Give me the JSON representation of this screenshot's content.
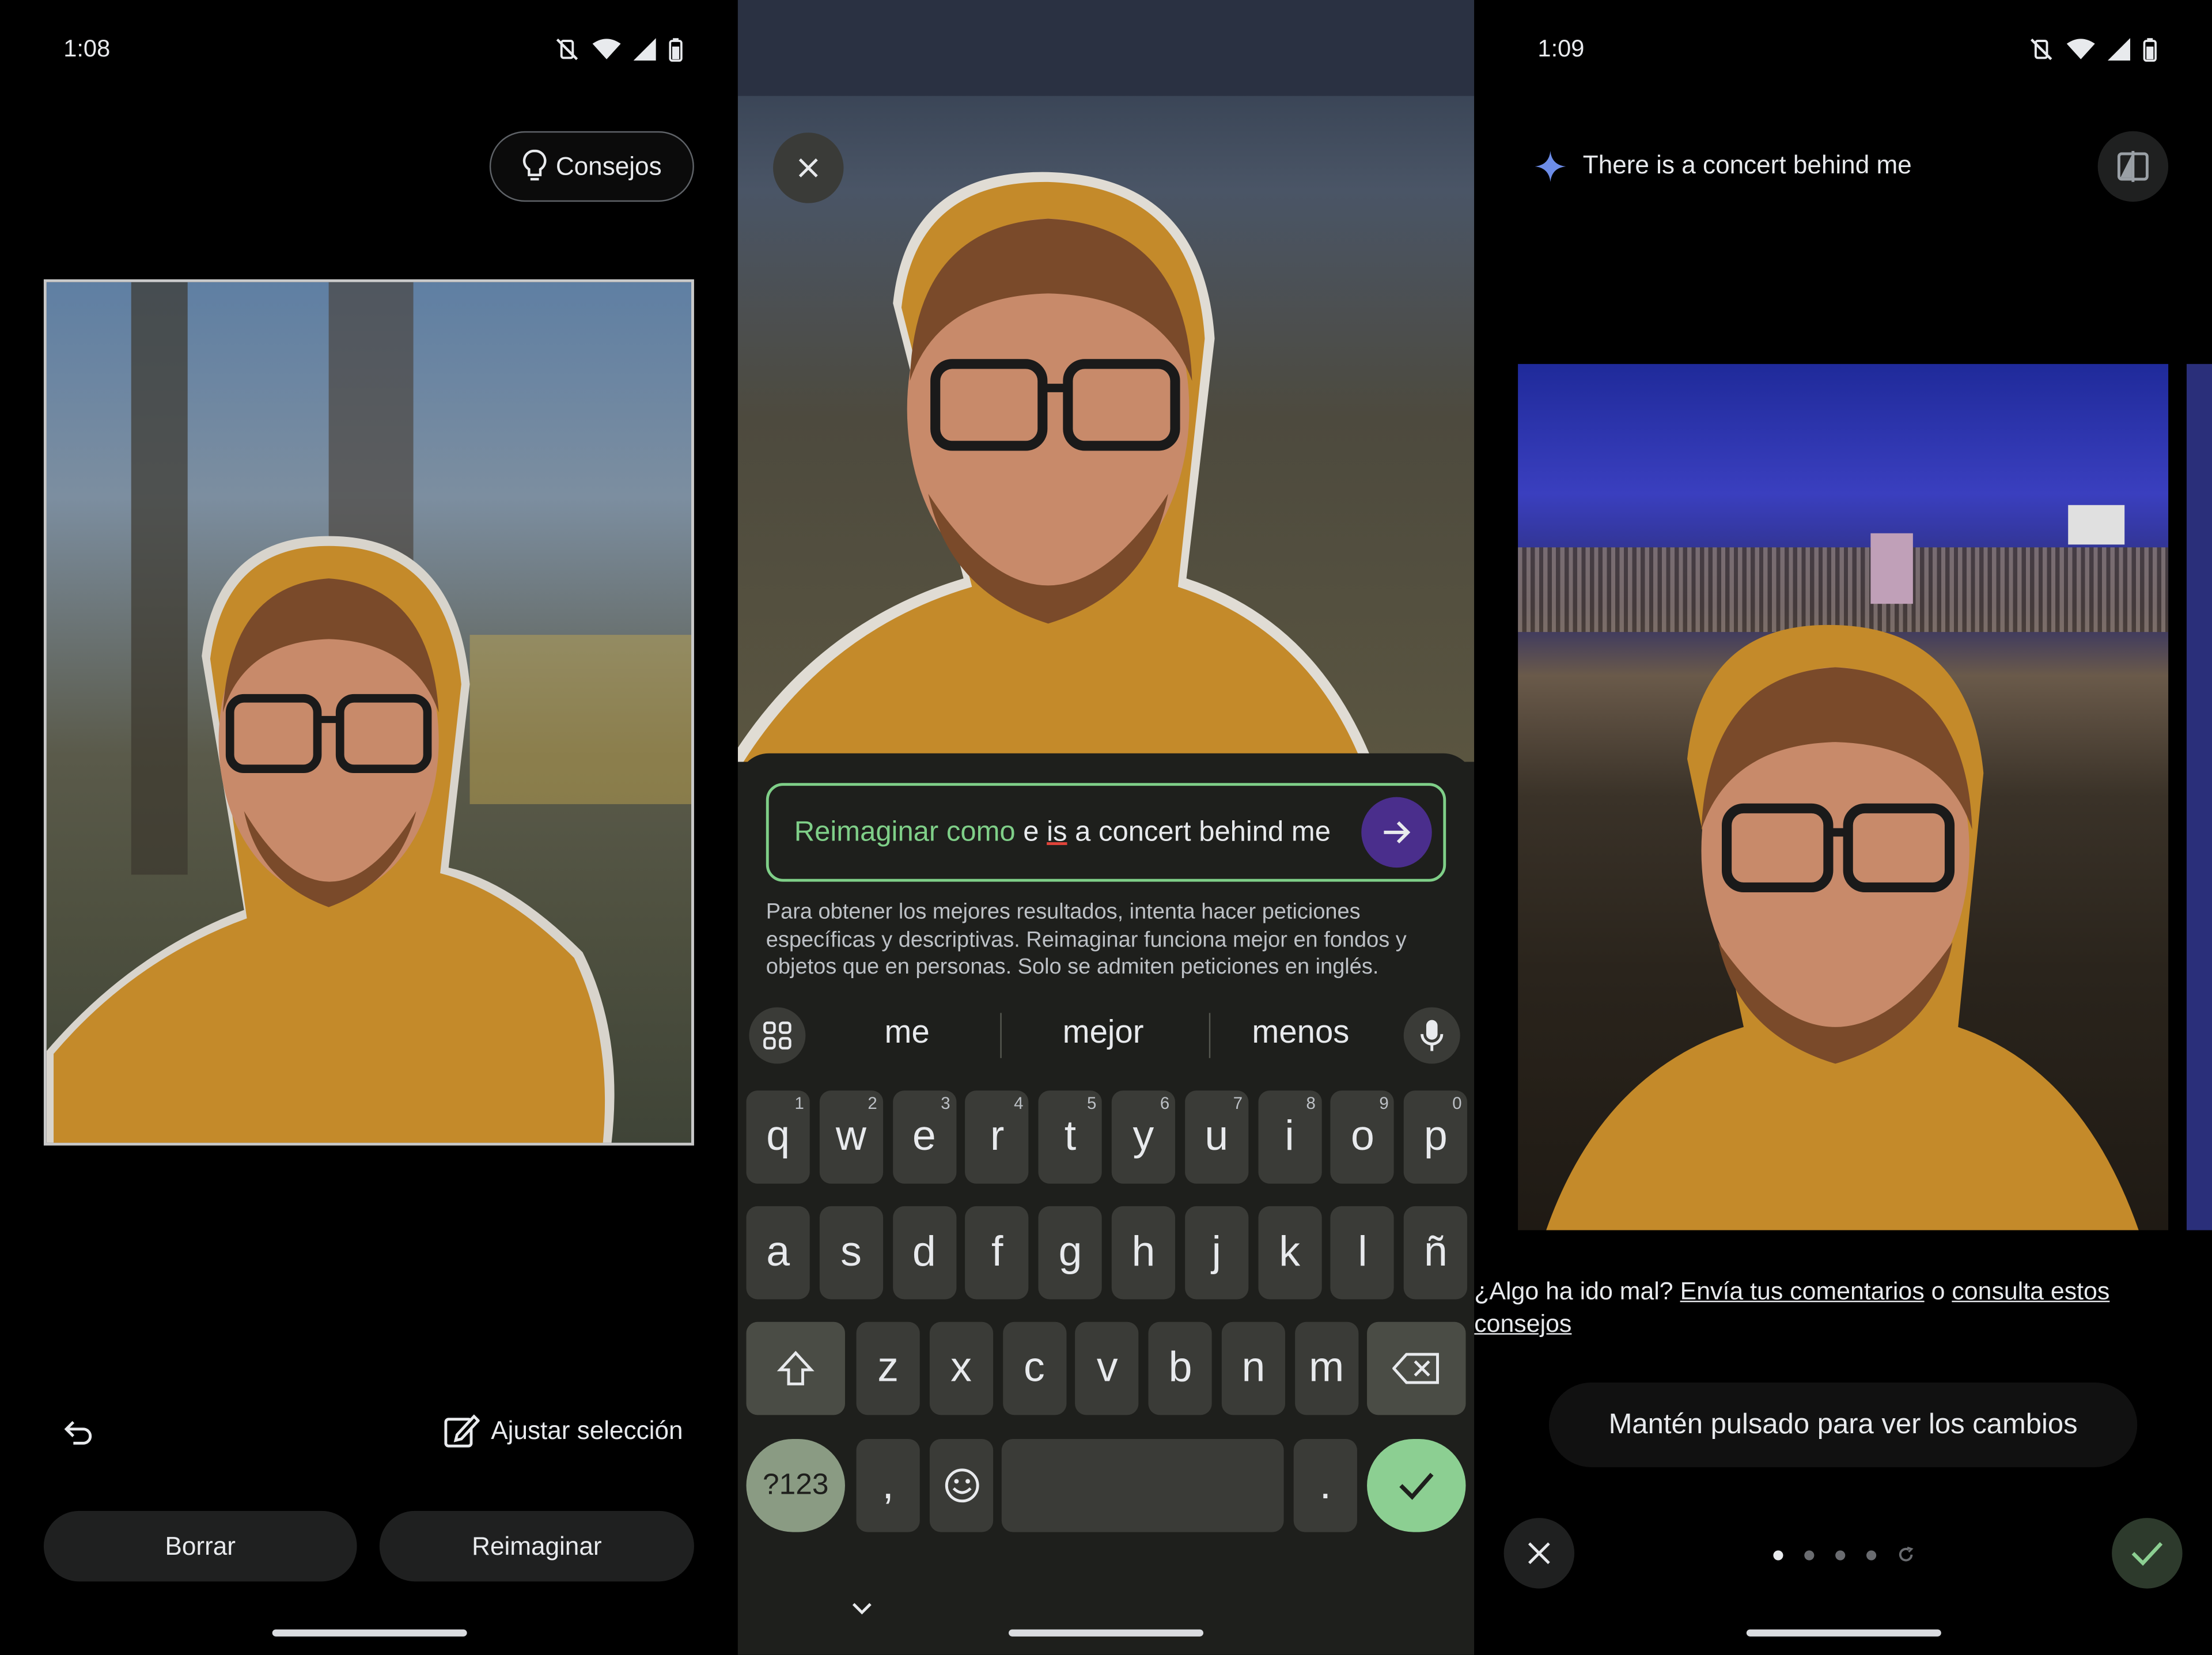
{
  "panel1": {
    "time": "1:08",
    "tips_button": "Consejos",
    "adjust_selection": "Ajustar selección",
    "erase_button": "Borrar",
    "reimagine_button": "Reimaginar"
  },
  "panel2": {
    "prompt_prefix": "Reimaginar como",
    "prompt_text_a": "e ",
    "prompt_text_b": "is",
    "prompt_text_c": " a concert behind me",
    "helper_text": "Para obtener los mejores resultados, intenta hacer peticiones específicas y descriptivas. Reimaginar funciona mejor en fondos y objetos que en personas. Solo se admiten peticiones en inglés.",
    "suggestions": [
      "me",
      "mejor",
      "menos"
    ],
    "row1": [
      {
        "k": "q",
        "n": "1"
      },
      {
        "k": "w",
        "n": "2"
      },
      {
        "k": "e",
        "n": "3"
      },
      {
        "k": "r",
        "n": "4"
      },
      {
        "k": "t",
        "n": "5"
      },
      {
        "k": "y",
        "n": "6"
      },
      {
        "k": "u",
        "n": "7"
      },
      {
        "k": "i",
        "n": "8"
      },
      {
        "k": "o",
        "n": "9"
      },
      {
        "k": "p",
        "n": "0"
      }
    ],
    "row2": [
      "a",
      "s",
      "d",
      "f",
      "g",
      "h",
      "j",
      "k",
      "l",
      "ñ"
    ],
    "row3": [
      "z",
      "x",
      "c",
      "v",
      "b",
      "n",
      "m"
    ],
    "symbols_key": "?123",
    "comma_key": ",",
    "period_key": "."
  },
  "panel3": {
    "time": "1:09",
    "prompt_display": "There is a concert behind me",
    "feedback_prefix": "¿Algo ha ido mal?",
    "feedback_link": "Envía tus comentarios",
    "feedback_or": "o",
    "tips_link": "consulta estos consejos",
    "hold_hint": "Mantén pulsado para ver los cambios",
    "page_dots_total": 4,
    "page_dots_active": 1
  },
  "colors": {
    "accent_green": "#7fcf88",
    "confirm_green": "#8ccf92",
    "send_purple": "#4a2e8c",
    "shirt": "#c48a2a"
  }
}
